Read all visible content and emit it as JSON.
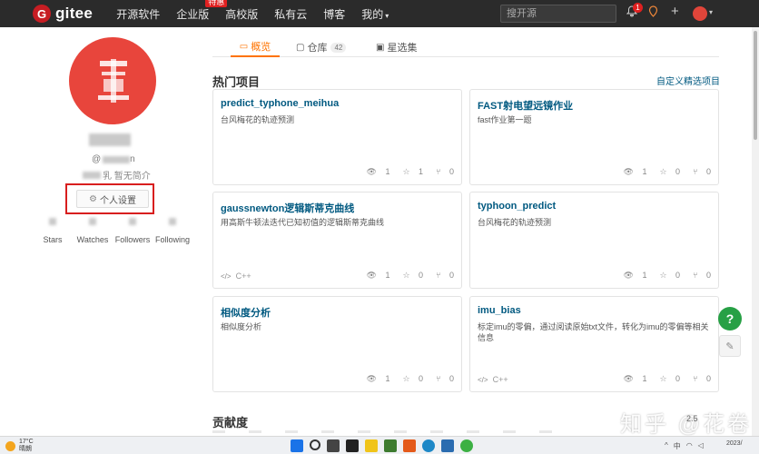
{
  "header": {
    "brand": "gitee",
    "logo_letter": "G",
    "nav": [
      {
        "label": "开源软件"
      },
      {
        "label": "企业版",
        "badge": "特惠"
      },
      {
        "label": "高校版"
      },
      {
        "label": "私有云"
      },
      {
        "label": "博客"
      },
      {
        "label": "我的",
        "caret": "▾"
      }
    ],
    "search_placeholder": "搜开源",
    "notification_count": "1"
  },
  "profile": {
    "handle_prefix": "@",
    "handle_suffix": "n",
    "bio_suffix": "乳 暂无简介",
    "settings_button": "个人设置",
    "stats": [
      {
        "label": "Stars"
      },
      {
        "label": "Watches"
      },
      {
        "label": "Followers"
      },
      {
        "label": "Following"
      }
    ]
  },
  "tabs": [
    {
      "label": "概览",
      "active": true
    },
    {
      "label": "仓库",
      "count": "42"
    },
    {
      "label": "星选集"
    }
  ],
  "popular": {
    "title": "热门项目",
    "customize_link": "自定义精选项目",
    "cards": [
      {
        "title": "predict_typhone_meihua",
        "desc": "台风梅花的轨迹预测",
        "lang": "",
        "watch": "1",
        "star": "1",
        "fork": "0"
      },
      {
        "title": "FAST射电望远镜作业",
        "desc": "fast作业第一题",
        "lang": "",
        "watch": "1",
        "star": "0",
        "fork": "0"
      },
      {
        "title": "gaussnewton逻辑斯蒂克曲线",
        "desc": "用高斯牛顿法迭代已知初值的逻辑斯蒂克曲线",
        "lang": "C++",
        "watch": "1",
        "star": "0",
        "fork": "0"
      },
      {
        "title": "typhoon_predict",
        "desc": "台风梅花的轨迹预测",
        "lang": "",
        "watch": "1",
        "star": "0",
        "fork": "0"
      },
      {
        "title": "相似度分析",
        "desc": "相似度分析",
        "lang": "",
        "watch": "1",
        "star": "0",
        "fork": "0"
      },
      {
        "title": "imu_bias",
        "desc": "标定imu的零偏，通过阅读原始txt文件，转化为imu的零偏等相关信息",
        "lang": "C++",
        "watch": "1",
        "star": "0",
        "fork": "0"
      }
    ]
  },
  "contributions": {
    "title": "贡献度"
  },
  "floating": {
    "help": "?",
    "feedback": "✎"
  },
  "watermark": "知乎 @花卷",
  "zoom_text": "2.5",
  "taskbar": {
    "temperature": "17°C",
    "weather": "晴朗",
    "tray_lang": "中",
    "clock": "2023/"
  },
  "colors": {
    "accent": "#fe7300",
    "link": "#005980",
    "brand_red": "#c71d23",
    "help_green": "#27a045",
    "highlight_frame": "#d81e1e"
  }
}
